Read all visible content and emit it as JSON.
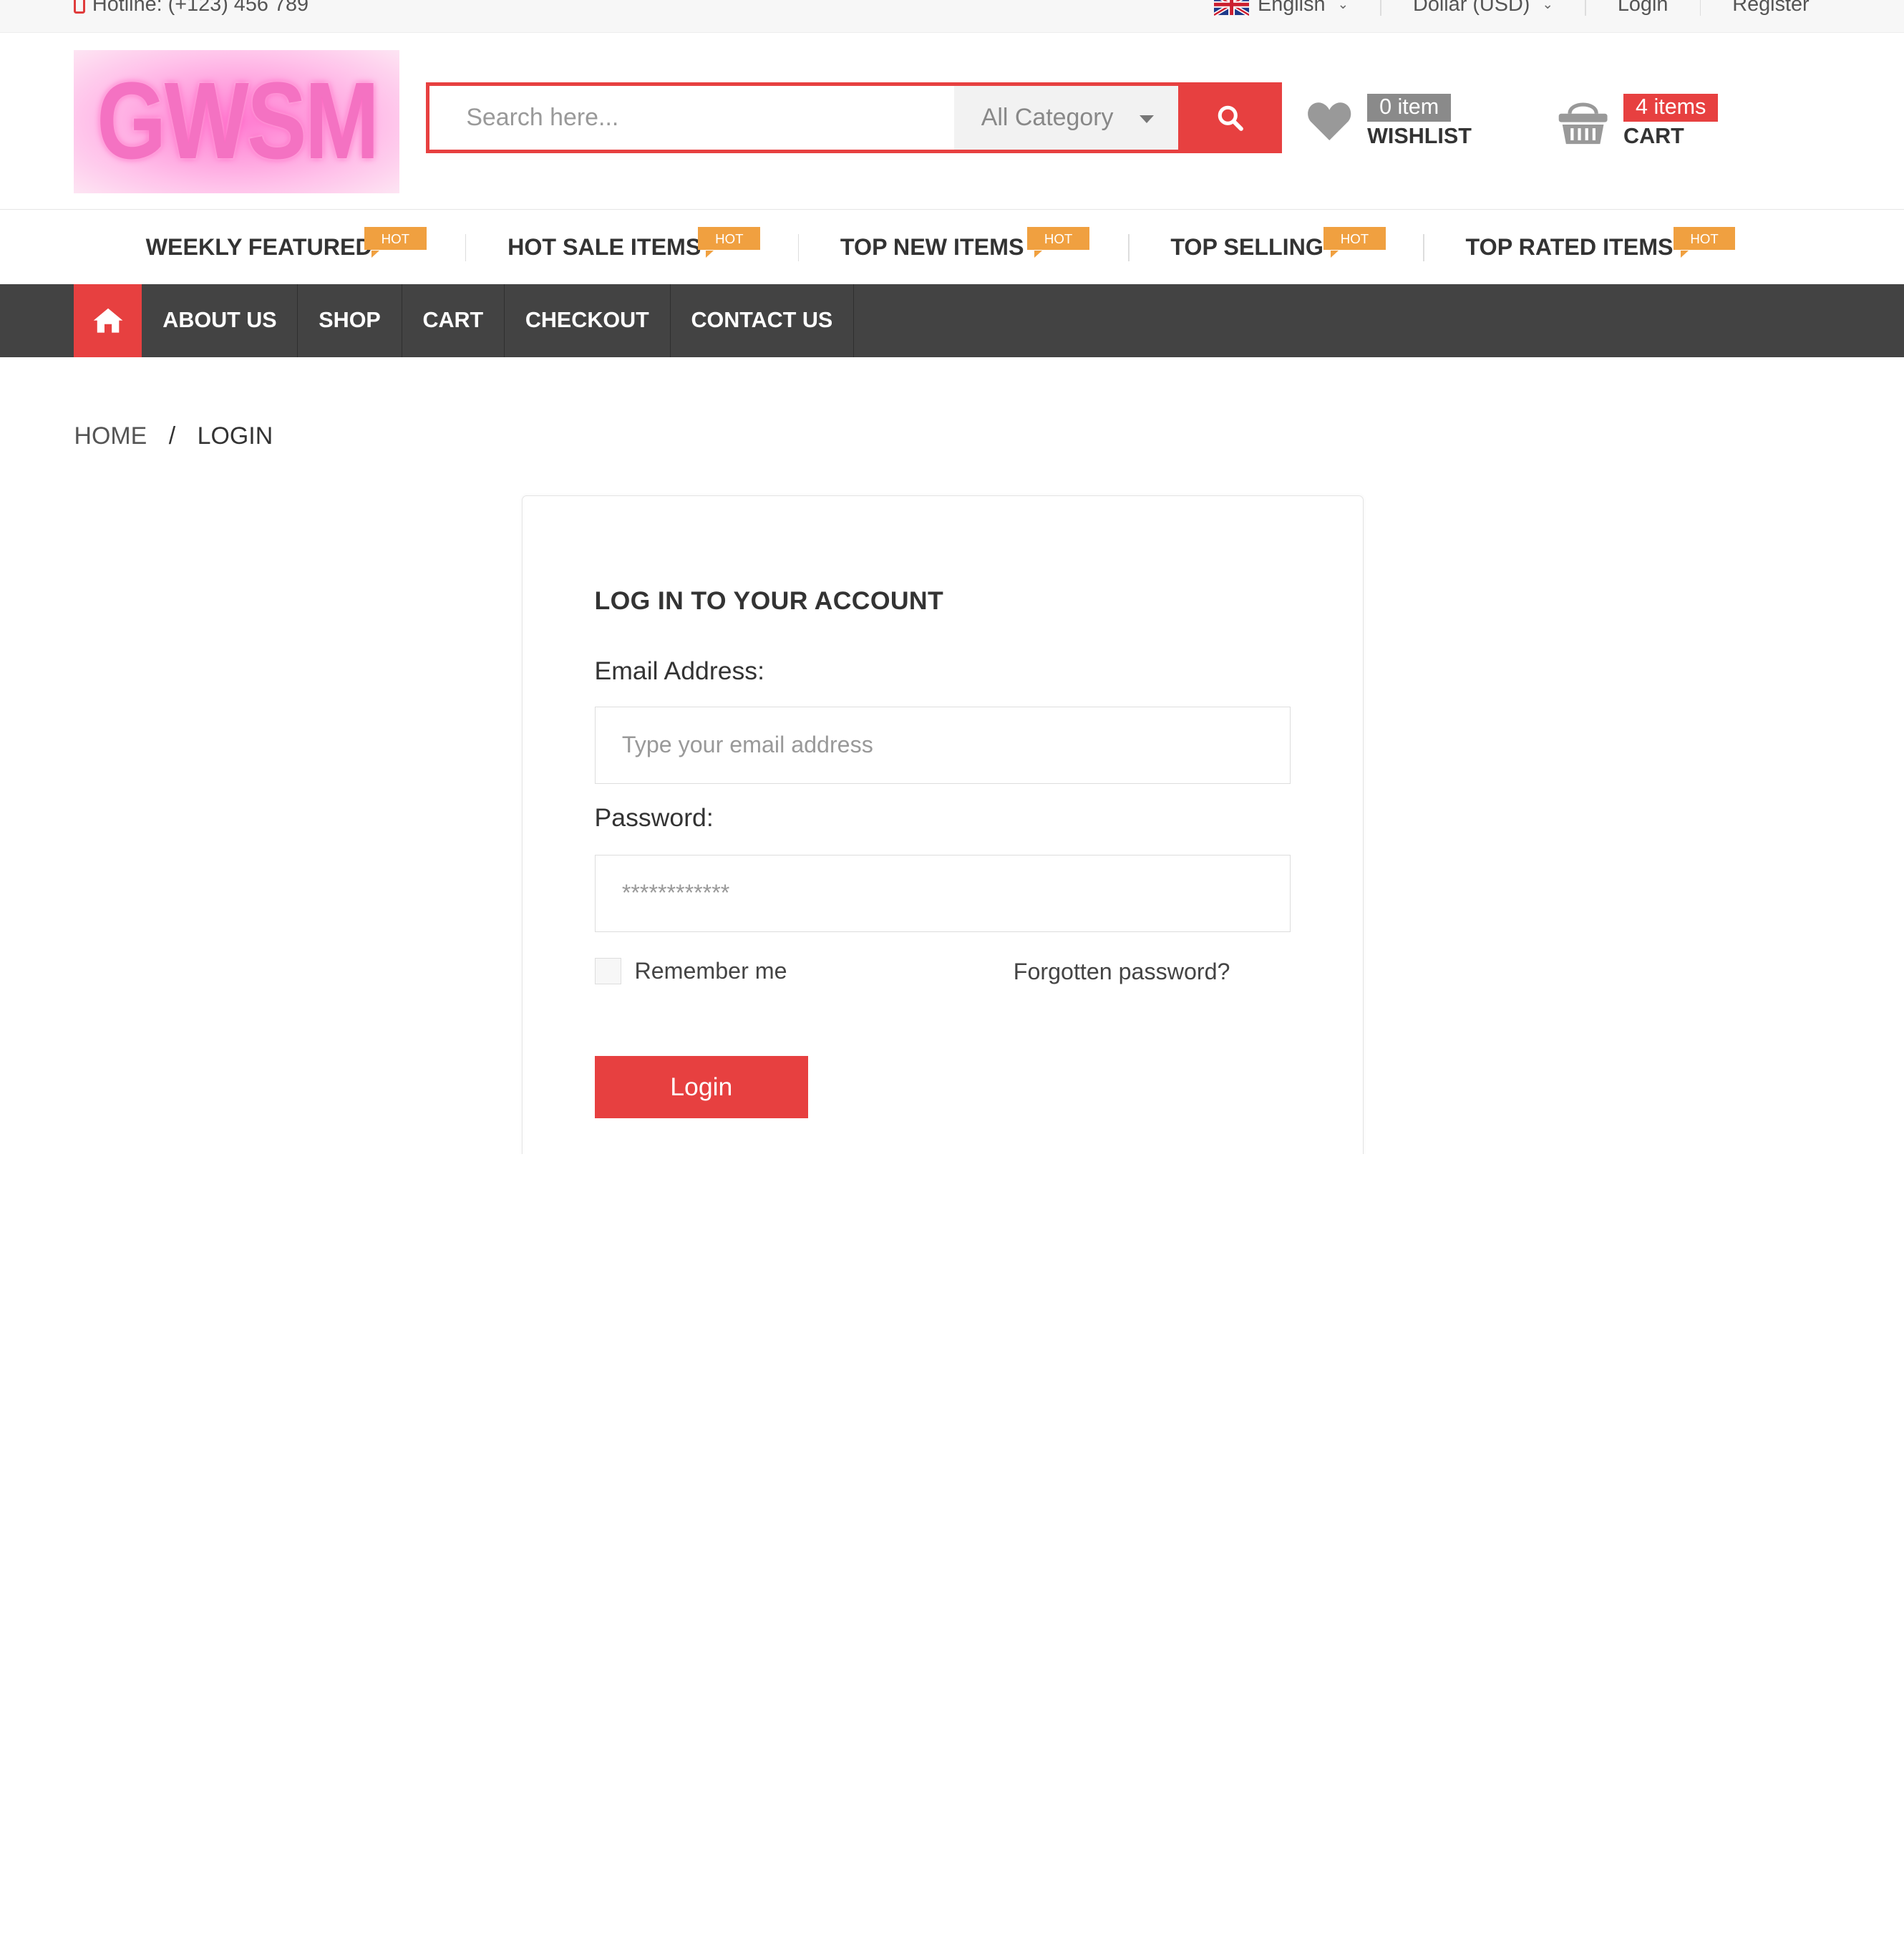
{
  "topbar": {
    "hotline": "Hotline: (+123) 456 789",
    "language": "English",
    "currency": "Dollar (USD)",
    "login": "Login",
    "register": "Register"
  },
  "logo": {
    "text": "GWSM"
  },
  "search": {
    "placeholder": "Search here...",
    "category": "All Category"
  },
  "wishlist": {
    "count": "0 item",
    "label": "WISHLIST"
  },
  "cart": {
    "count": "4 items",
    "label": "CART"
  },
  "hot_items": [
    {
      "label": "WEEKLY FEATURED",
      "tag": "HOT"
    },
    {
      "label": "HOT SALE ITEMS",
      "tag": "HOT"
    },
    {
      "label": "TOP NEW ITEMS",
      "tag": "HOT"
    },
    {
      "label": "TOP SELLING",
      "tag": "HOT"
    },
    {
      "label": "TOP RATED ITEMS",
      "tag": "HOT"
    }
  ],
  "nav": [
    "ABOUT US",
    "SHOP",
    "CART",
    "CHECKOUT",
    "CONTACT US"
  ],
  "breadcrumb": {
    "home": "HOME",
    "sep": "/",
    "current": "LOGIN"
  },
  "login_form": {
    "title": "LOG IN TO YOUR ACCOUNT",
    "email_label": "Email Address:",
    "email_placeholder": "Type your email address",
    "password_label": "Password:",
    "password_placeholder": "************",
    "remember": "Remember me",
    "forgot": "Forgotten password?",
    "submit": "Login"
  },
  "colors": {
    "accent": "#e74040",
    "nav_bg": "#434343",
    "hot_tag": "#f0a040",
    "logo_pink": "#f472c2"
  }
}
